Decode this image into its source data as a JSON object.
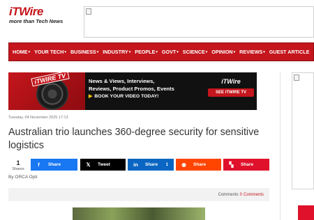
{
  "header": {
    "logo_word": "iTWire",
    "logo_tagline": "more than Tech News"
  },
  "nav": {
    "items": [
      {
        "label": "HOME",
        "dropdown": true
      },
      {
        "label": "YOUR TECH",
        "dropdown": true
      },
      {
        "label": "BUSINESS",
        "dropdown": true
      },
      {
        "label": "INDUSTRY",
        "dropdown": true
      },
      {
        "label": "PEOPLE",
        "dropdown": true
      },
      {
        "label": "GOVT",
        "dropdown": true
      },
      {
        "label": "SCIENCE",
        "dropdown": true
      },
      {
        "label": "OPINION",
        "dropdown": true
      },
      {
        "label": "REVIEWS",
        "dropdown": true
      },
      {
        "label": "GUEST ARTICLE",
        "dropdown": false
      }
    ],
    "caret": "▾"
  },
  "promo": {
    "badge": "iTWIRE TV",
    "line1": "News & Views, Interviews,",
    "line2": "Reviews, Product Promos, Events",
    "cta": "BOOK YOUR VIDEO TODAY!",
    "right_logo": "iTWire",
    "button": "SEE iTWIRE TV"
  },
  "article": {
    "date": "Tuesday, 04 November 2025 17:13",
    "title": "Australian trio launches 360-degree security for sensitive logistics",
    "byline": "By ORCA Opti"
  },
  "share": {
    "count": "1",
    "count_label": "Shares",
    "buttons": {
      "facebook": {
        "label": "Share",
        "icon": "f"
      },
      "x": {
        "label": "Tweet",
        "icon": "𝕏"
      },
      "linkedin": {
        "label": "Share",
        "icon": "in",
        "count": "1"
      },
      "reddit": {
        "label": "Share",
        "icon": "◉"
      },
      "flipboard": {
        "label": "Share",
        "icon": "▚"
      }
    }
  },
  "comments": {
    "prefix": "Comments",
    "count": "0",
    "link": "Comments"
  },
  "colors": {
    "brand_red": "#c4161c",
    "facebook": "#1877f2",
    "x": "#000000",
    "linkedin": "#0a66c2",
    "reddit": "#ff4500",
    "flipboard": "#e0112b"
  }
}
